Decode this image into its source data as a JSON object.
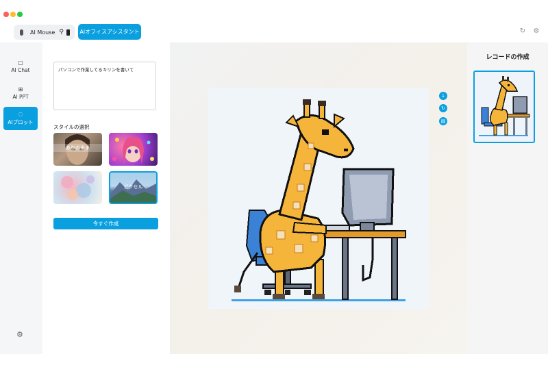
{
  "header": {
    "device": {
      "name": "AI Mouse",
      "mouse_icon": "mouse-icon",
      "usb_icon": "usb-icon",
      "battery_icon": "battery-icon"
    },
    "mode_button": "AIオフィスアシスタント",
    "icons": [
      "refresh-icon",
      "gear-icon"
    ]
  },
  "sidebar": {
    "items": [
      {
        "label": "AI Chat",
        "icon": "chat-icon"
      },
      {
        "label": "AI PPT",
        "icon": "presentation-icon"
      },
      {
        "label": "AIプロット",
        "icon": "brush-icon",
        "active": true
      }
    ],
    "settings_icon": "gear-icon"
  },
  "panel": {
    "prompt_value": "パソコンで作業してるキリンを書いて",
    "style_heading": "スタイルの選択",
    "styles": [
      {
        "label": "ありのまま"
      },
      {
        "label": ""
      },
      {
        "label": ""
      },
      {
        "label": "ピクセル",
        "selected": true
      }
    ],
    "create_button": "今すぐ作成"
  },
  "canvas": {
    "image_subject": "pixel-art giraffe working at a computer",
    "actions": [
      "download-icon",
      "regenerate-icon",
      "delete-icon"
    ]
  },
  "records": {
    "title": "レコードの作成"
  },
  "colors": {
    "accent": "#0aa0e0",
    "sidebar_bg": "#f5f6f8",
    "records_bg": "#f5f5f5"
  }
}
